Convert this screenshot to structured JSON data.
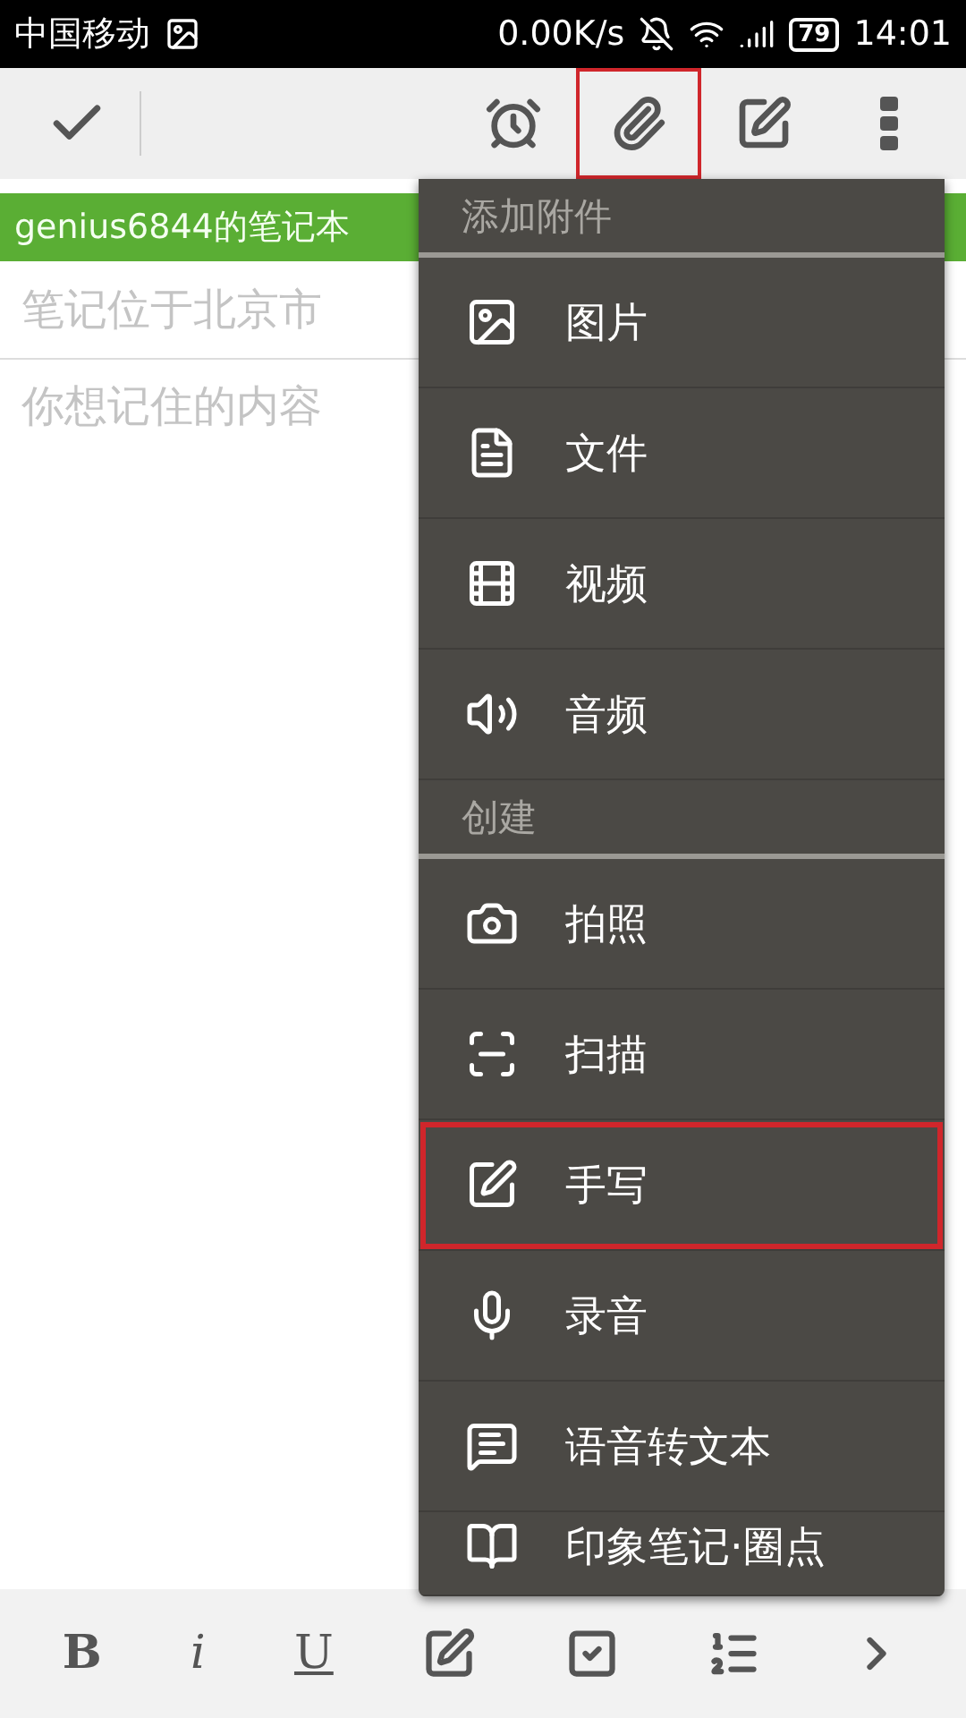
{
  "status_bar": {
    "carrier": "中国移动",
    "speed": "0.00K/s",
    "battery": "79",
    "time": "14:01"
  },
  "toolbar": {
    "items": [
      {
        "kind": "done",
        "highlighted": false
      },
      {
        "kind": "reminder",
        "highlighted": false
      },
      {
        "kind": "attach",
        "highlighted": true
      },
      {
        "kind": "handwrite",
        "highlighted": false
      },
      {
        "kind": "more",
        "highlighted": false
      }
    ]
  },
  "notebook": "genius6844的笔记本",
  "title_field": {
    "placeholder": "笔记位于北京市"
  },
  "body_field": {
    "placeholder": "你想记住的内容"
  },
  "menu": {
    "sections": [
      {
        "title": "添加附件",
        "items": [
          {
            "label": "图片",
            "highlighted": false
          },
          {
            "label": "文件",
            "highlighted": false
          },
          {
            "label": "视频",
            "highlighted": false
          },
          {
            "label": "音频",
            "highlighted": false
          }
        ]
      },
      {
        "title": "创建",
        "items": [
          {
            "label": "拍照",
            "highlighted": false
          },
          {
            "label": "扫描",
            "highlighted": false
          },
          {
            "label": "手写",
            "highlighted": true
          },
          {
            "label": "录音",
            "highlighted": false
          },
          {
            "label": "语音转文本",
            "highlighted": false
          },
          {
            "label": "印象笔记·圈点",
            "highlighted": false
          }
        ]
      }
    ]
  },
  "format_bar": {
    "items": [
      {
        "kind": "text",
        "label": "B"
      },
      {
        "kind": "text",
        "label": "i"
      },
      {
        "kind": "text",
        "label": "U"
      },
      {
        "kind": "icon"
      },
      {
        "kind": "icon"
      },
      {
        "kind": "icon"
      },
      {
        "kind": "icon"
      }
    ]
  }
}
